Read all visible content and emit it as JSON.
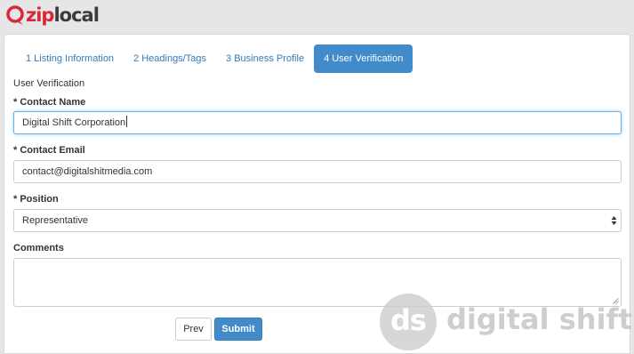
{
  "brand": {
    "logo_prefix": "zip",
    "logo_suffix": "local",
    "accent_color": "#d8283a"
  },
  "tabs": [
    {
      "label": "1 Listing Information",
      "active": false
    },
    {
      "label": "2 Headings/Tags",
      "active": false
    },
    {
      "label": "3 Business Profile",
      "active": false
    },
    {
      "label": "4 User Verification",
      "active": true
    }
  ],
  "form": {
    "section_title": "User Verification",
    "required_marker": "*",
    "contact_name": {
      "label": "Contact Name",
      "value": "Digital Shift Corporation"
    },
    "contact_email": {
      "label": "Contact Email",
      "value": "contact@digitalshitmedia.com"
    },
    "position": {
      "label": "Position",
      "value": "Representative"
    },
    "comments": {
      "label": "Comments",
      "value": ""
    }
  },
  "buttons": {
    "prev_label": "Prev",
    "submit_label": "Submit",
    "primary_color": "#428bca"
  },
  "watermark": {
    "badge_text": "ds",
    "text": "digital shift"
  }
}
